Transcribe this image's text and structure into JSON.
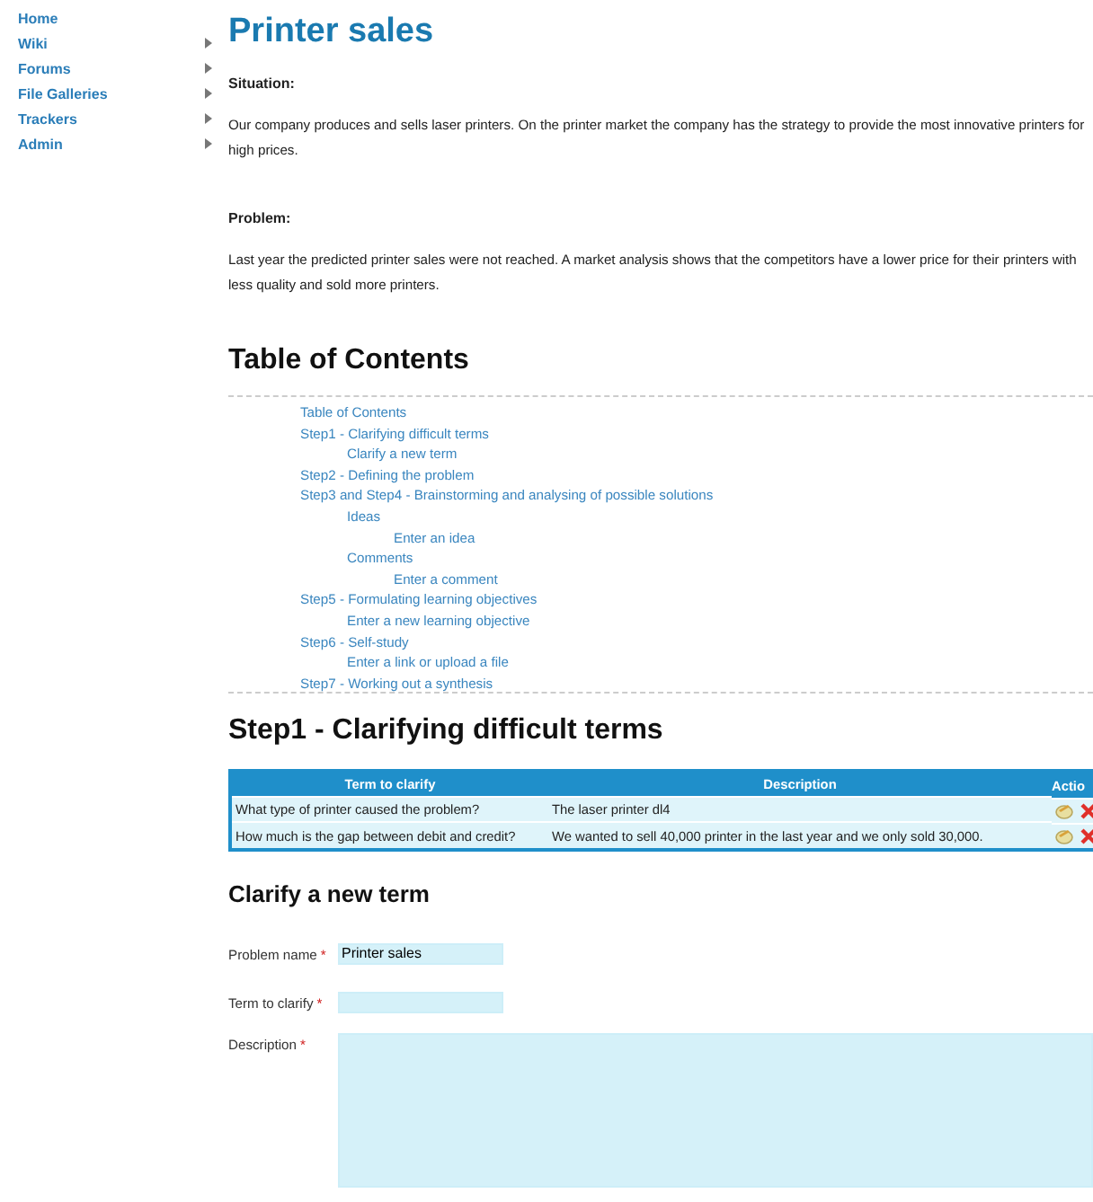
{
  "sidebar": {
    "items": [
      {
        "label": "Home",
        "has_submenu": false
      },
      {
        "label": "Wiki",
        "has_submenu": true
      },
      {
        "label": "Forums",
        "has_submenu": true
      },
      {
        "label": "File Galleries",
        "has_submenu": true
      },
      {
        "label": "Trackers",
        "has_submenu": true
      },
      {
        "label": "Admin",
        "has_submenu": true
      }
    ]
  },
  "page_title": "Printer sales",
  "sections": [
    {
      "heading": "Situation:",
      "text": "Our company produces and sells laser printers. On the printer market the company has the strategy to provide the most innovative printers for high prices."
    },
    {
      "heading": "Problem:",
      "text": "Last year the predicted printer sales were not reached. A market analysis shows that the competitors have a lower price for their printers with less quality and sold more printers."
    }
  ],
  "toc": {
    "heading": "Table of Contents",
    "items": [
      {
        "label": "Table of Contents"
      },
      {
        "label": "Step1 - Clarifying difficult terms",
        "children": [
          {
            "label": "Clarify a new term"
          }
        ]
      },
      {
        "label": "Step2 - Defining the problem"
      },
      {
        "label": "Step3 and Step4 - Brainstorming and analysing of possible solutions",
        "children": [
          {
            "label": "Ideas",
            "children": [
              {
                "label": "Enter an idea"
              }
            ]
          },
          {
            "label": "Comments",
            "children": [
              {
                "label": "Enter a comment"
              }
            ]
          }
        ]
      },
      {
        "label": "Step5 - Formulating learning objectives",
        "children": [
          {
            "label": "Enter a new learning objective"
          }
        ]
      },
      {
        "label": "Step6 - Self-study",
        "children": [
          {
            "label": "Enter a link or upload a file"
          }
        ]
      },
      {
        "label": "Step7 - Working out a synthesis"
      }
    ]
  },
  "step1": {
    "heading": "Step1 - Clarifying difficult terms",
    "table": {
      "columns": [
        "Term to clarify",
        "Description",
        "Actio"
      ],
      "rows": [
        {
          "term": "What type of printer caused the problem?",
          "description": "The laser printer dl4"
        },
        {
          "term": "How much is the gap between debit and credit?",
          "description": "We wanted to sell 40,000 printer in the last year and we only sold 30,000."
        }
      ]
    }
  },
  "form": {
    "heading": "Clarify a new term",
    "fields": [
      {
        "label": "Problem name",
        "required_mark": "*",
        "kind": "input",
        "value": "Printer sales"
      },
      {
        "label": "Term to clarify",
        "required_mark": "*",
        "kind": "input"
      },
      {
        "label": "Description",
        "required_mark": "*",
        "kind": "textarea"
      }
    ]
  }
}
